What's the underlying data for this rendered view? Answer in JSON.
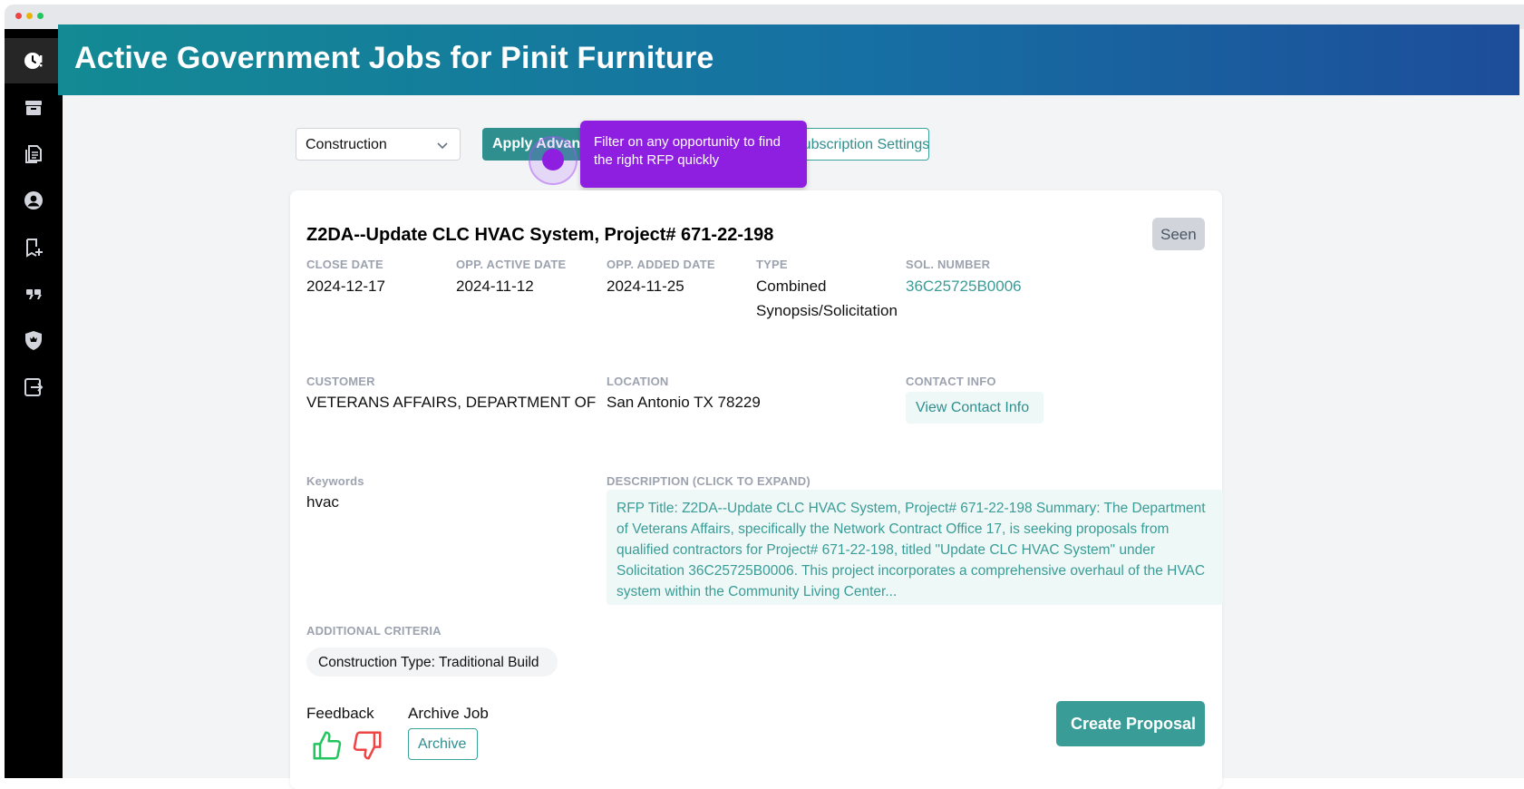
{
  "header": {
    "title": "Active Government Jobs for Pinit Furniture"
  },
  "sidebar": {
    "items": [
      {
        "icon": "clock-alert-icon",
        "active": true
      },
      {
        "icon": "archive-box-icon",
        "active": false
      },
      {
        "icon": "documents-icon",
        "active": false
      },
      {
        "icon": "user-circle-icon",
        "active": false
      },
      {
        "icon": "bookmark-add-icon",
        "active": false
      },
      {
        "icon": "quote-icon",
        "active": false
      },
      {
        "icon": "shield-crown-icon",
        "active": false
      },
      {
        "icon": "logout-icon",
        "active": false
      }
    ]
  },
  "filters": {
    "category_selected": "Construction",
    "apply_label": "Apply Advanced",
    "subscription_label": "Subscription Settings"
  },
  "tooltip": {
    "text": "Filter on any opportunity to find the right RFP quickly"
  },
  "job": {
    "title": "Z2DA--Update CLC HVAC System, Project# 671-22-198",
    "seen_label": "Seen",
    "close_date_label": "CLOSE DATE",
    "close_date": "2024-12-17",
    "active_date_label": "OPP. ACTIVE DATE",
    "active_date": "2024-11-12",
    "added_date_label": "OPP. ADDED DATE",
    "added_date": "2024-11-25",
    "type_label": "TYPE",
    "type_line1": "Combined",
    "type_line2": "Synopsis/Solicitation",
    "sol_label": "SOL. NUMBER",
    "sol_number": "36C25725B0006",
    "customer_label": "CUSTOMER",
    "customer": "VETERANS AFFAIRS, DEPARTMENT OF",
    "location_label": "LOCATION",
    "location": "San Antonio TX 78229",
    "contact_label": "CONTACT INFO",
    "contact_button": "View Contact Info",
    "keywords_label": "Keywords",
    "keywords": "hvac",
    "description_label": "DESCRIPTION (CLICK TO EXPAND)",
    "description": "RFP Title: Z2DA--Update CLC HVAC System, Project# 671-22-198 Summary: The Department of Veterans Affairs, specifically the Network Contract Office 17, is seeking proposals from qualified contractors for Project# 671-22-198, titled \"Update CLC HVAC System\" under Solicitation 36C25725B0006. This project incorporates a comprehensive overhaul of the HVAC system within the Community Living Center...",
    "criteria_label": "ADDITIONAL CRITERIA",
    "criteria_pill": "Construction Type: Traditional Build",
    "feedback_label": "Feedback",
    "archive_label": "Archive Job",
    "archive_button": "Archive",
    "create_button": "Create Proposal"
  },
  "colors": {
    "accent": "#3a9c97",
    "tooltip": "#8e1fe0",
    "thumb_up": "#22c55e",
    "thumb_down": "#ef4444"
  }
}
